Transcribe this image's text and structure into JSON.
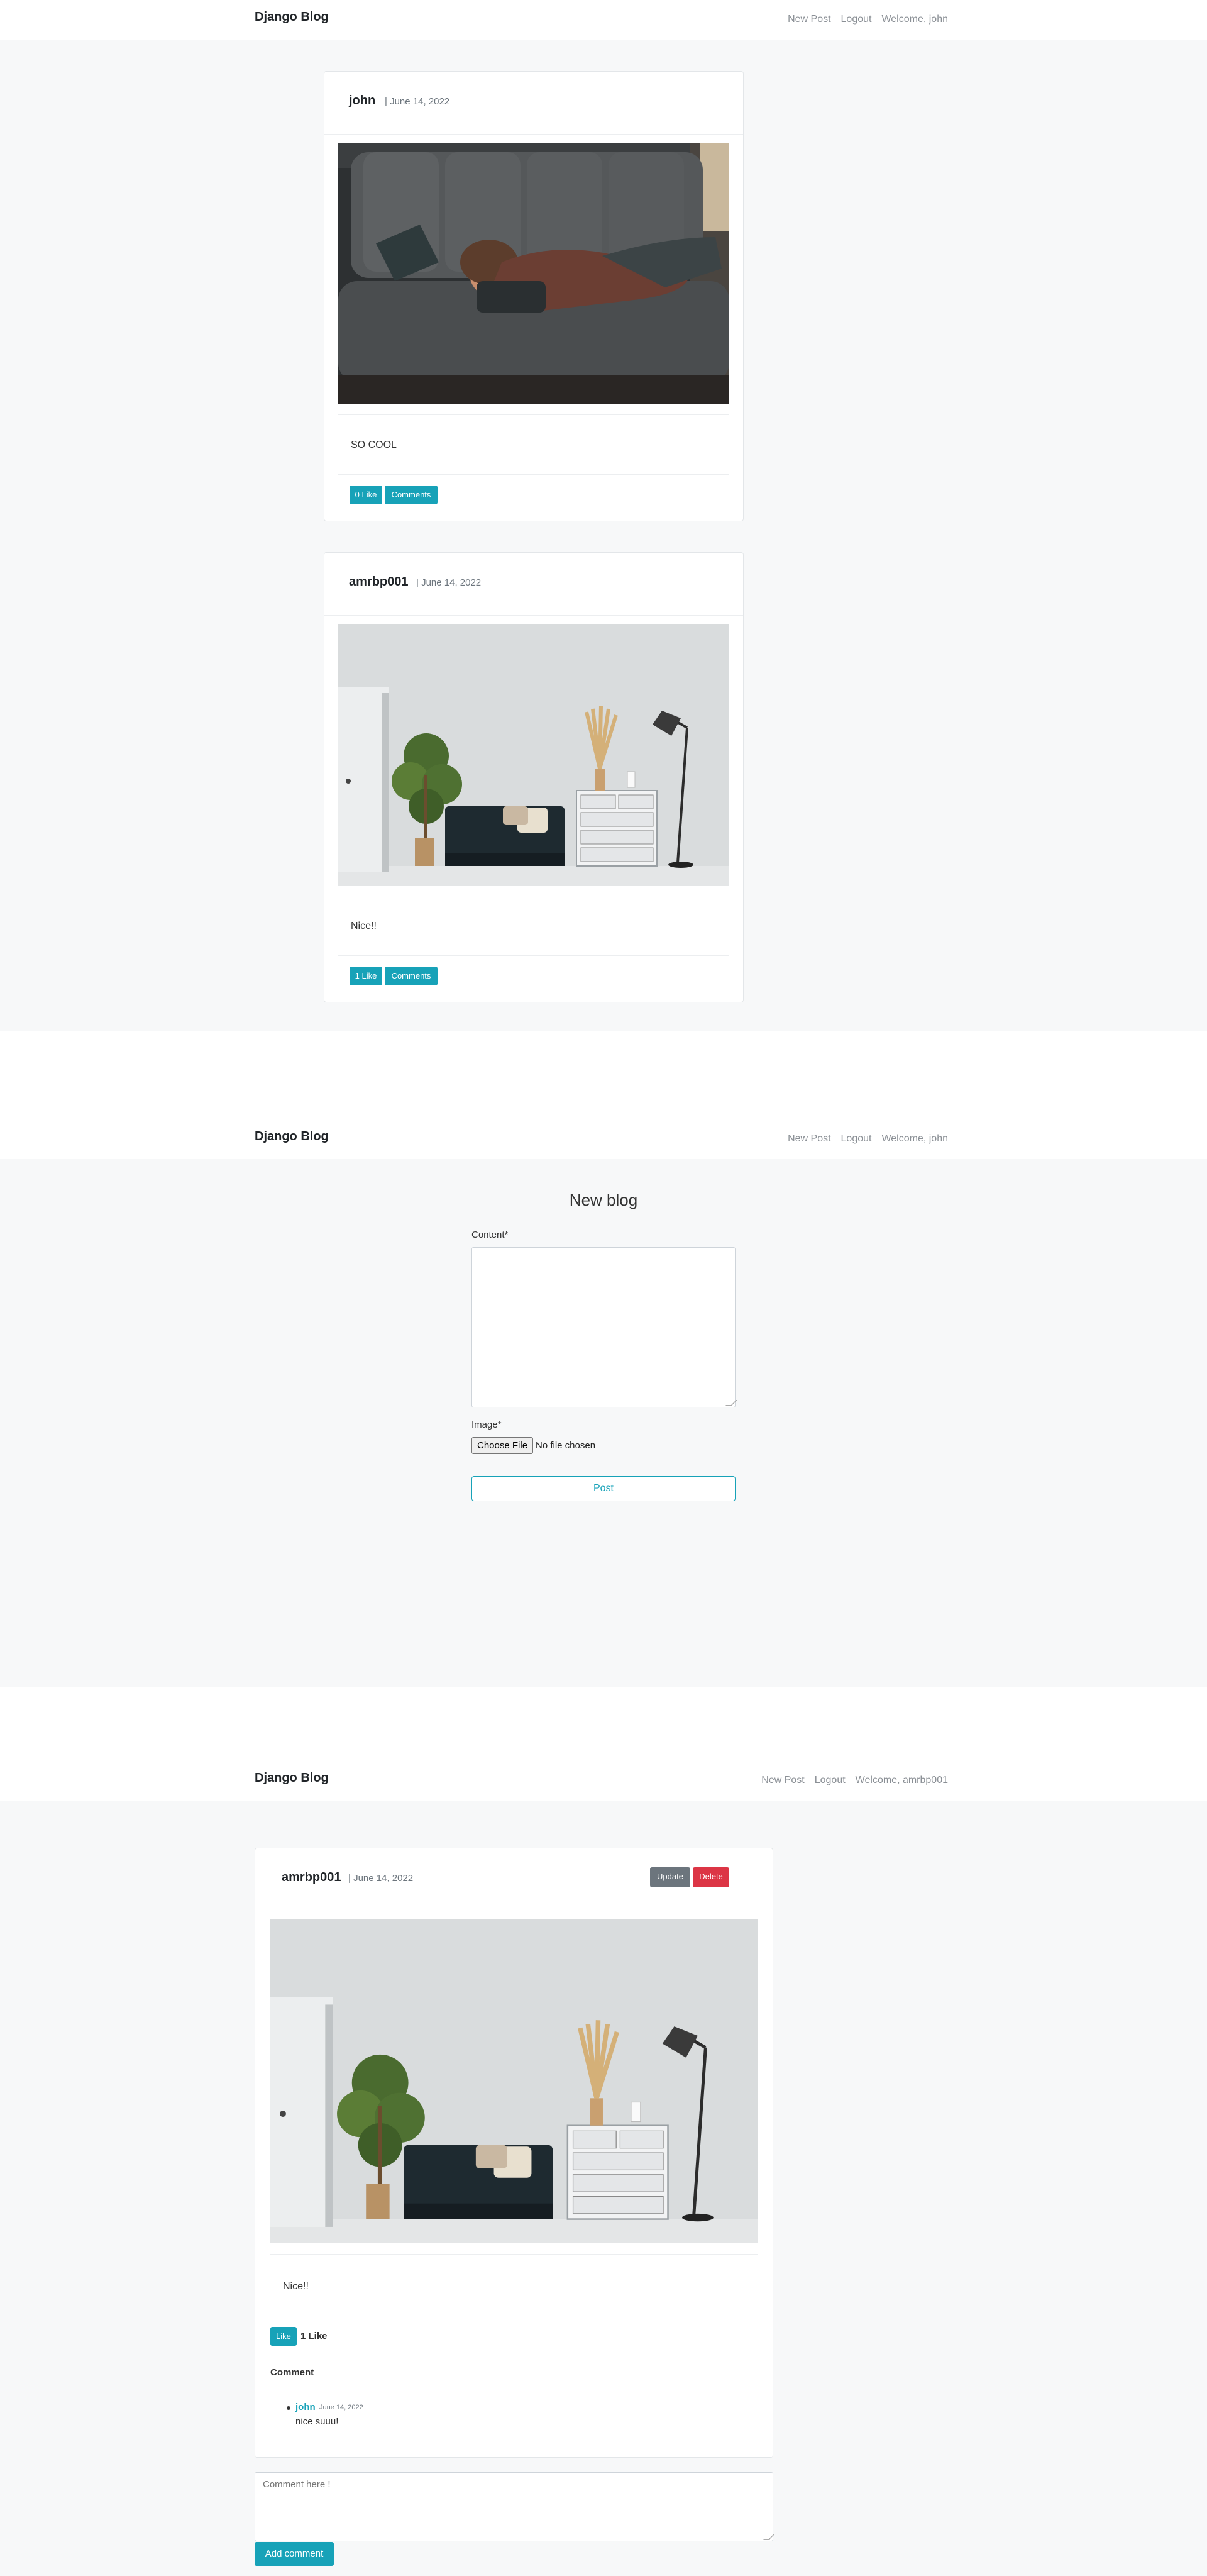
{
  "navbar1": {
    "brand": "Django Blog",
    "links": [
      "New Post",
      "Logout",
      "Welcome, john"
    ]
  },
  "feed": {
    "posts": [
      {
        "author": "john",
        "date": "| June 14, 2022",
        "image": "person-sleeping-on-sofa",
        "text": "SO COOL",
        "like_label": "0 Like",
        "comments_label": "Comments"
      },
      {
        "author": "amrbp001",
        "date": "| June 14, 2022",
        "image": "living-room-interior",
        "text": "Nice!!",
        "like_label": "1 Like",
        "comments_label": "Comments"
      }
    ]
  },
  "navbar2": {
    "brand": "Django Blog",
    "links": [
      "New Post",
      "Logout",
      "Welcome, john"
    ]
  },
  "new_blog": {
    "title": "New blog",
    "content_label": "Content*",
    "content_value": "",
    "image_label": "Image*",
    "file_button": "Choose File",
    "file_status": "No file chosen",
    "submit": "Post"
  },
  "navbar3": {
    "brand": "Django Blog",
    "links": [
      "New Post",
      "Logout",
      "Welcome, amrbp001"
    ]
  },
  "detail": {
    "author": "amrbp001",
    "date": "| June 14, 2022",
    "update": "Update",
    "delete": "Delete",
    "image": "living-room-interior",
    "text": "Nice!!",
    "like_button": "Like",
    "like_count": "1 Like",
    "comment_heading": "Comment",
    "comments": [
      {
        "author": "john",
        "date": "June 14, 2022",
        "body": "nice suuu!"
      }
    ],
    "comment_placeholder": "Comment here !",
    "add_comment": "Add comment"
  },
  "colors": {
    "accent": "#17a2b8",
    "danger": "#dc3545",
    "secondary": "#6c757d",
    "page_bg": "#f7f8f9"
  }
}
